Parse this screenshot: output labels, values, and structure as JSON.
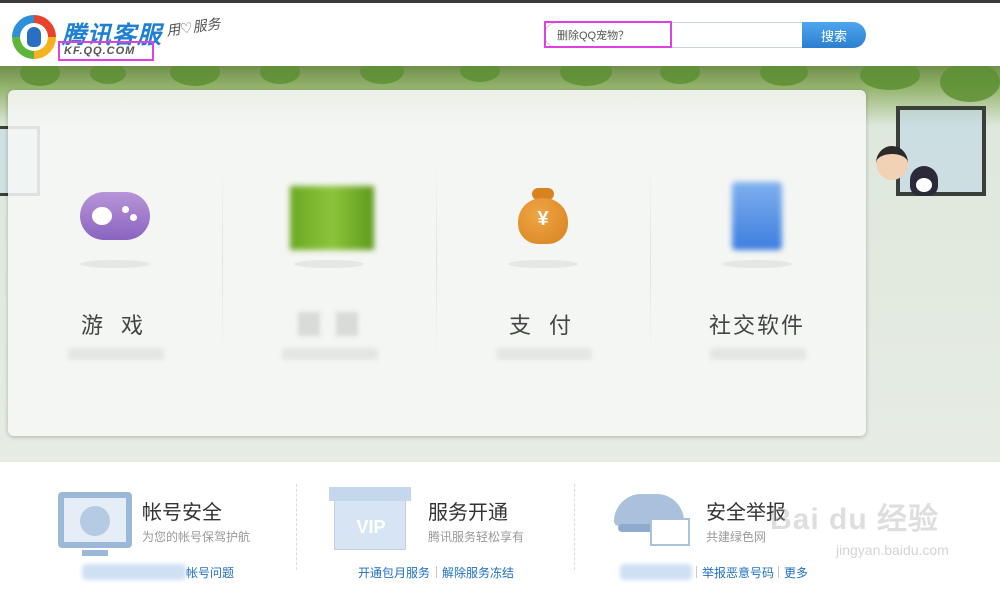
{
  "header": {
    "brand_title": "腾讯客服",
    "brand_domain": "KF.QQ.COM",
    "brand_slogan": "用♡服务",
    "search_value": "删除QQ宠物？",
    "search_button": "搜索"
  },
  "categories": [
    {
      "label": "游 戏",
      "icon": "gamepad-icon"
    },
    {
      "label": "",
      "icon": "blurred-icon"
    },
    {
      "label": "支 付",
      "icon": "money-bag-icon",
      "symbol": "¥"
    },
    {
      "label": "社交软件",
      "icon": "blurred-icon"
    }
  ],
  "services": [
    {
      "title": "帐号安全",
      "desc": "为您的帐号保驾护航",
      "icon": "monitor-lock-icon",
      "links": [
        "帐号问题"
      ]
    },
    {
      "title": "服务开通",
      "desc": "腾讯服务轻松享有",
      "icon": "vip-box-icon",
      "icon_text": "VIP",
      "links": [
        "开通包月服务",
        "解除服务冻结"
      ]
    },
    {
      "title": "安全举报",
      "desc": "共建绿色网",
      "icon": "police-cap-icon",
      "links": [
        "举报恶意号码",
        "更多"
      ]
    }
  ],
  "watermark": {
    "text": "Bai du 经验",
    "url": "jingyan.baidu.com"
  },
  "colors": {
    "brand_blue": "#1f7fd2",
    "highlight_magenta": "#e040e0",
    "link_blue": "#1f6fbf",
    "search_button": "#2c7fd0"
  }
}
